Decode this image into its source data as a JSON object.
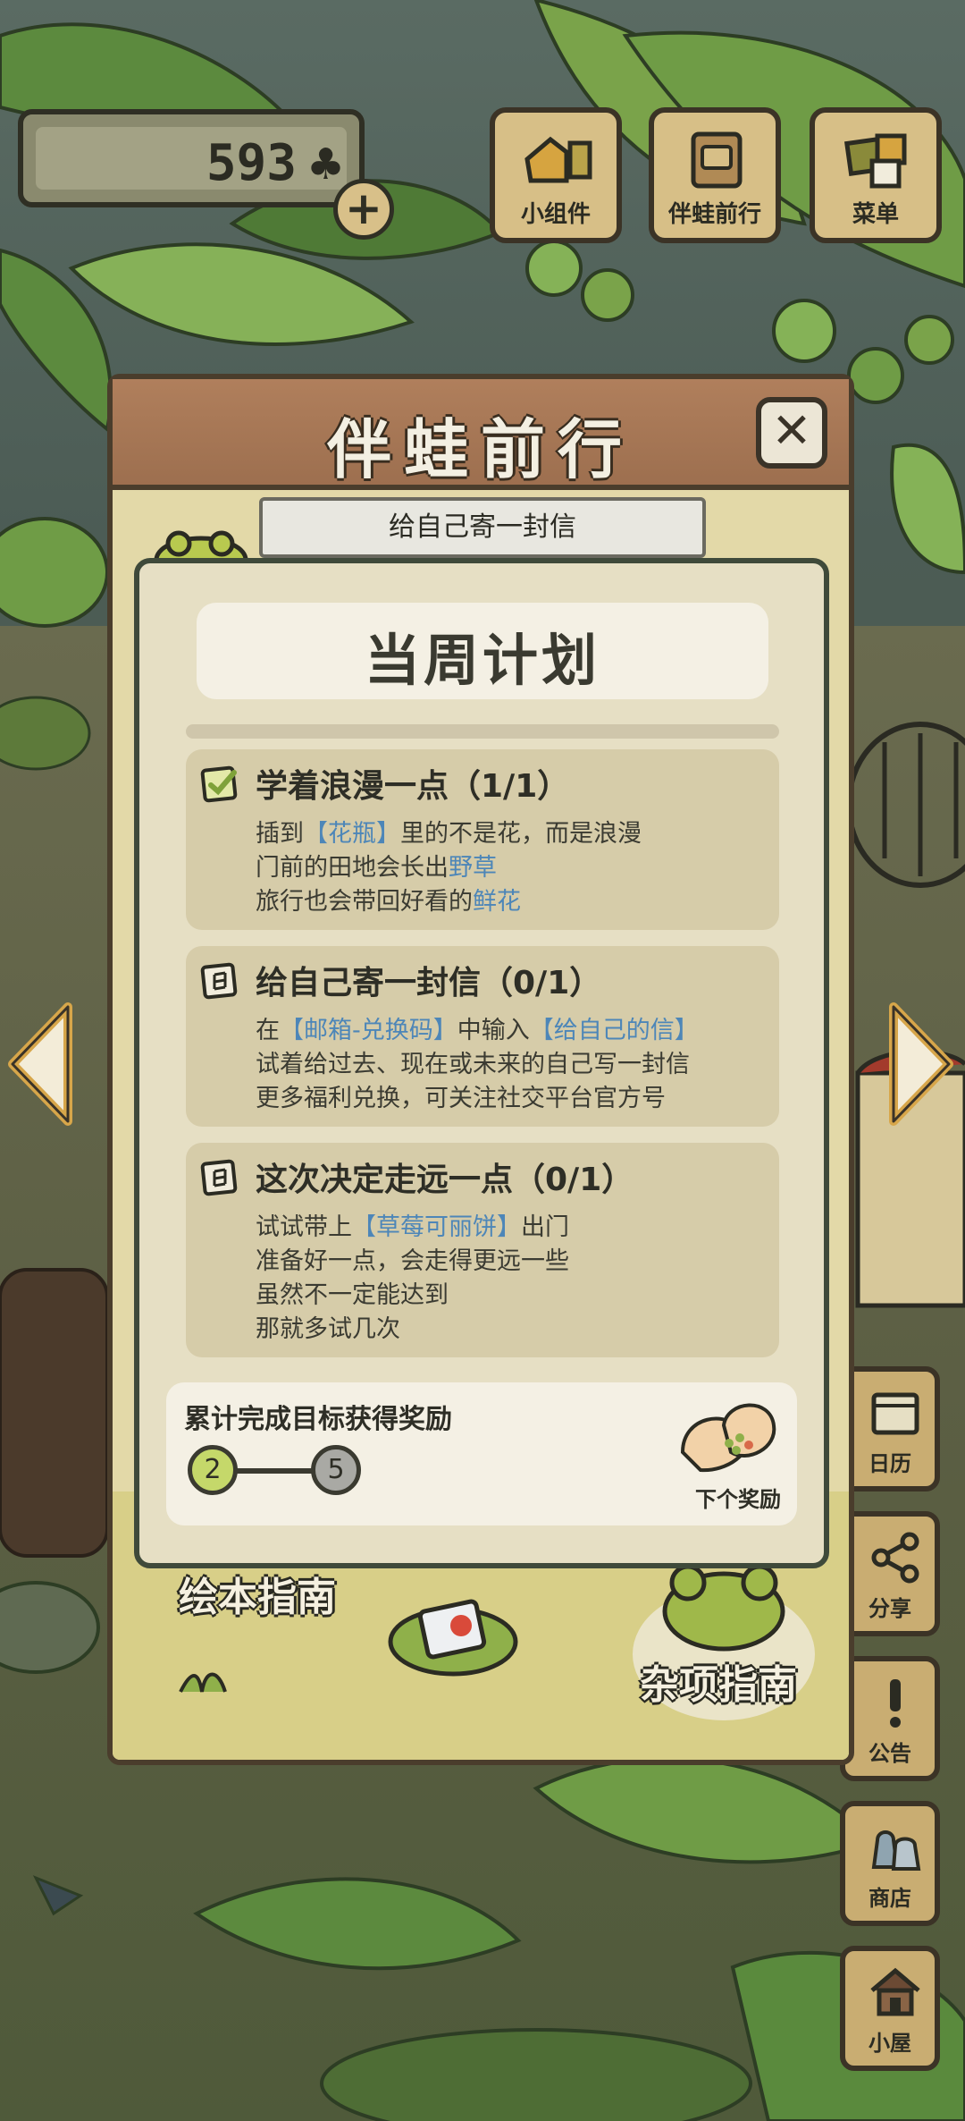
{
  "hud": {
    "clover_count": "593",
    "clover_icon": "♣",
    "plus": "+"
  },
  "top_menu": [
    {
      "label": "小组件",
      "icon": "widget-icon"
    },
    {
      "label": "伴蛙前行",
      "icon": "journal-icon"
    },
    {
      "label": "菜单",
      "icon": "menu-icon"
    }
  ],
  "side_menu": [
    {
      "label": "日历",
      "icon": "calendar-icon"
    },
    {
      "label": "分享",
      "icon": "share-icon"
    },
    {
      "label": "公告",
      "icon": "notice-icon"
    },
    {
      "label": "商店",
      "icon": "shop-icon"
    },
    {
      "label": "小屋",
      "icon": "house-icon"
    }
  ],
  "panel": {
    "title": "伴蛙前行",
    "close": "✕",
    "banner": "给自己寄一封信",
    "guides": [
      "绘本指南",
      "杂项指南"
    ]
  },
  "plan": {
    "title": "当周计划",
    "tasks": [
      {
        "title": "学着浪漫一点（1/1）",
        "status": "done",
        "lines": [
          [
            {
              "t": "插到"
            },
            {
              "t": "【花瓶】",
              "hl": true
            },
            {
              "t": "里的不是花，而是浪漫"
            }
          ],
          [
            {
              "t": "门前的田地会长出"
            },
            {
              "t": "野草",
              "hl": true
            }
          ],
          [
            {
              "t": "旅行也会带回好看的"
            },
            {
              "t": "鲜花",
              "hl": true
            }
          ]
        ]
      },
      {
        "title": "给自己寄一封信（0/1）",
        "status": "todo",
        "lines": [
          [
            {
              "t": "在"
            },
            {
              "t": "【邮箱-兑换码】",
              "hl": true
            },
            {
              "t": "中输入"
            },
            {
              "t": "【给自己的信】",
              "hl": true
            }
          ],
          [
            {
              "t": "试着给过去、现在或未来的自己写一封信"
            }
          ],
          [
            {
              "t": "更多福利兑换，可关注社交平台官方号"
            }
          ]
        ]
      },
      {
        "title": "这次决定走远一点（0/1）",
        "status": "todo",
        "lines": [
          [
            {
              "t": "试试带上"
            },
            {
              "t": "【草莓可丽饼】",
              "hl": true
            },
            {
              "t": "出门"
            }
          ],
          [
            {
              "t": "准备好一点，会走得更远一些"
            }
          ],
          [
            {
              "t": "虽然不一定能达到"
            }
          ],
          [
            {
              "t": "那就多试几次"
            }
          ]
        ]
      }
    ],
    "reward": {
      "title": "累计完成目标获得奖励",
      "current": "2",
      "goal": "5",
      "next_label": "下个奖励",
      "progress_fraction": 0.4
    }
  },
  "colors": {
    "highlight": "#4d86b8",
    "progress_done": "#c5d86a",
    "progress_todo": "#a9a9a4"
  }
}
